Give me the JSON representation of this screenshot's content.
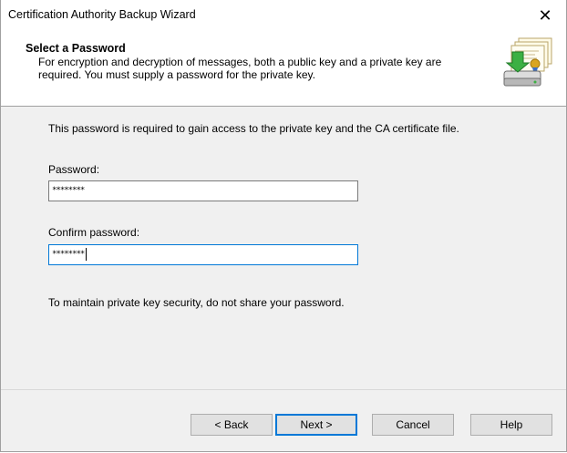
{
  "window": {
    "title": "Certification Authority Backup Wizard",
    "close_glyph": "✕"
  },
  "header": {
    "title": "Select a Password",
    "description": "For encryption and decryption of messages, both a public key and a private key are required. You must supply a password for the private key.",
    "icon": "certificate-backup-icon"
  },
  "body": {
    "intro": "This password is required to gain access to the private key and the CA certificate file.",
    "password_label": "Password:",
    "password_value": "********",
    "confirm_label": "Confirm password:",
    "confirm_value": "********",
    "note": "To maintain private key security, do not share your password."
  },
  "buttons": {
    "back": "< Back",
    "next": "Next >",
    "cancel": "Cancel",
    "help": "Help"
  },
  "colors": {
    "accent": "#0078d7",
    "dialog_bg": "#f0f0f0",
    "button_bg": "#e1e1e1"
  }
}
